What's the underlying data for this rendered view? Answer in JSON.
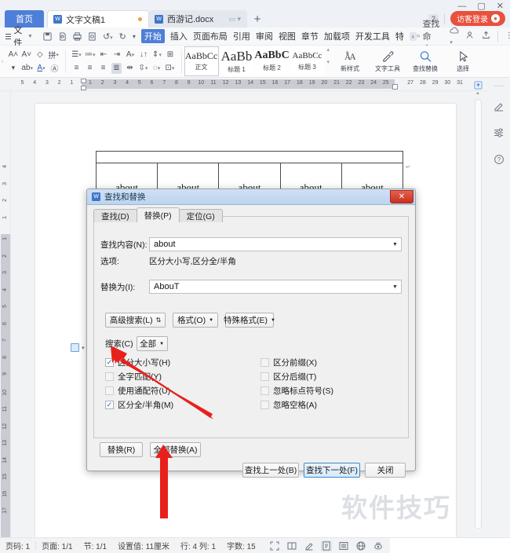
{
  "window": {
    "minimize": "—",
    "maximize": "▢",
    "close": "✕"
  },
  "tabbar": {
    "home_label": "首页",
    "tabs": [
      {
        "label": "文字文稿1",
        "icon": "wps-writer-icon",
        "state": "active",
        "modified": true
      },
      {
        "label": "西游记.docx",
        "icon": "wps-writer-icon",
        "state": "inactive",
        "modified": false
      }
    ],
    "new_tab": "+",
    "count_badge": "2",
    "login_label": "访客登录"
  },
  "menubar": {
    "file_label": "文件",
    "quick_icons": [
      "save-icon",
      "print-preview-icon",
      "print-icon",
      "search-doc-icon",
      "undo-icon",
      "redo-icon",
      "touch-mode-icon"
    ],
    "items": [
      {
        "label": "开始",
        "selected": true
      },
      {
        "label": "插入",
        "selected": false
      },
      {
        "label": "页面布局",
        "selected": false
      },
      {
        "label": "引用",
        "selected": false
      },
      {
        "label": "审阅",
        "selected": false
      },
      {
        "label": "视图",
        "selected": false
      },
      {
        "label": "章节",
        "selected": false
      },
      {
        "label": "加载项",
        "selected": false
      },
      {
        "label": "开发工具",
        "selected": false
      },
      {
        "label": "特",
        "selected": false
      }
    ],
    "more": "›",
    "search_placeholder": "查找命令...",
    "right_icons": [
      "cloud-icon",
      "share-user-icon",
      "upload-icon",
      "more-dots-icon",
      "collapse-ribbon-icon"
    ]
  },
  "ribbon": {
    "font_group": [
      [
        "grow-font-icon",
        "shrink-font-icon",
        "clear-format-icon",
        "pinyin-guide-icon"
      ],
      [
        "text-highlight-icon",
        "strikethrough-icon",
        "font-color-icon",
        "char-border-icon"
      ]
    ],
    "para_group": [
      [
        "bullets-icon",
        "numbering-icon",
        "decrease-indent-icon",
        "increase-indent-icon",
        "asian-layout-icon",
        "sort-icon",
        "line-spacing-icon",
        "borders-icon"
      ],
      [
        "align-left-icon",
        "align-center-icon",
        "align-right-icon",
        "align-justify-icon",
        "distribute-icon",
        "paragraph-spacing-icon",
        "shading-icon",
        "table-borders-icon"
      ]
    ],
    "styles": [
      {
        "preview": "AaBbCc",
        "name": "正文",
        "size": 12,
        "weight": "normal",
        "active": true
      },
      {
        "preview": "AaBb",
        "name": "标题 1",
        "size": 17,
        "weight": "normal",
        "active": false
      },
      {
        "preview": "AaBbC",
        "name": "标题 2",
        "size": 14,
        "weight": "bold",
        "active": false
      },
      {
        "preview": "AaBbCc",
        "name": "标题 3",
        "size": 12,
        "weight": "normal",
        "active": false
      }
    ],
    "buttons": [
      {
        "label": "新样式",
        "icon": "new-style-icon",
        "dropdown": true
      },
      {
        "label": "文字工具",
        "icon": "text-tools-icon",
        "dropdown": true
      },
      {
        "label": "查找替换",
        "icon": "find-replace-icon",
        "dropdown": true
      },
      {
        "label": "选择",
        "icon": "select-icon",
        "dropdown": true
      }
    ]
  },
  "ruler": {
    "left_numbers": [
      "5",
      "4",
      "3",
      "2",
      "1"
    ],
    "numbers": [
      "1",
      "2",
      "3",
      "4",
      "5",
      "6",
      "7",
      "8",
      "9",
      "10",
      "11",
      "12",
      "13",
      "14",
      "15",
      "16",
      "17",
      "18",
      "19",
      "20",
      "21",
      "22",
      "23",
      "24",
      "25"
    ],
    "right_numbers": [
      "27",
      "28",
      "29",
      "30",
      "31"
    ],
    "vertical_top": [
      "4",
      "3",
      "2",
      "1"
    ],
    "vertical_numbers": [
      "1",
      "2",
      "3",
      "4",
      "5",
      "6",
      "7",
      "8",
      "9",
      "10",
      "11",
      "12",
      "13",
      "14",
      "15",
      "16",
      "17"
    ]
  },
  "document": {
    "table_cells": [
      "about",
      "about",
      "about",
      "about",
      "about"
    ],
    "pilcrow": "↵",
    "watermark": "软件技巧"
  },
  "right_sidebar": {
    "icons": [
      "pen-icon",
      "adjust-sliders-icon",
      "help-icon"
    ]
  },
  "dialog": {
    "title": "查找和替换",
    "close_label": "✕",
    "tabs": [
      {
        "label": "查找(D)",
        "selected": false
      },
      {
        "label": "替换(P)",
        "selected": true
      },
      {
        "label": "定位(G)",
        "selected": false
      }
    ],
    "find_label": "查找内容(N):",
    "find_value": "about",
    "options_label": "选项:",
    "options_value": "区分大小写,区分全/半角",
    "replace_label": "替换为(I):",
    "replace_value": "AbouT",
    "mid_buttons": [
      {
        "label": "高级搜索(L)",
        "marker": "⇅"
      },
      {
        "label": "格式(O)",
        "marker": "▼"
      },
      {
        "label": "特殊格式(E)",
        "marker": "▼"
      }
    ],
    "search_scope_label": "搜索(C)",
    "search_scope_value": "全部",
    "checkboxes_left": [
      {
        "label": "区分大小写(H)",
        "checked": true
      },
      {
        "label": "全字匹配(Y)",
        "checked": false
      },
      {
        "label": "使用通配符(U)",
        "checked": false
      },
      {
        "label": "区分全/半角(M)",
        "checked": true
      }
    ],
    "checkboxes_right": [
      {
        "label": "区分前缀(X)",
        "checked": false
      },
      {
        "label": "区分后缀(T)",
        "checked": false
      },
      {
        "label": "忽略标点符号(S)",
        "checked": false
      },
      {
        "label": "忽略空格(A)",
        "checked": false
      }
    ],
    "bottom_left_buttons": [
      {
        "label": "替换(R)",
        "primary": false
      },
      {
        "label": "全部替换(A)",
        "primary": false
      }
    ],
    "bottom_right_buttons": [
      {
        "label": "查找上一处(B)",
        "primary": false
      },
      {
        "label": "查找下一处(F)",
        "primary": true
      },
      {
        "label": "关闭",
        "primary": false
      }
    ]
  },
  "statusbar": {
    "segments": [
      "页码: 1",
      "页面: 1/1",
      "节: 1/1",
      "设置值: 11厘米",
      "行: 4   列: 1",
      "字数: 15"
    ],
    "view_icons": [
      "fullscreen-icon",
      "two-page-icon",
      "highlight-pen-icon",
      "print-layout-icon",
      "outline-view-icon",
      "web-layout-icon",
      "eye-protection-icon"
    ]
  },
  "annotations": {
    "arrow_color": "#e8201b"
  }
}
